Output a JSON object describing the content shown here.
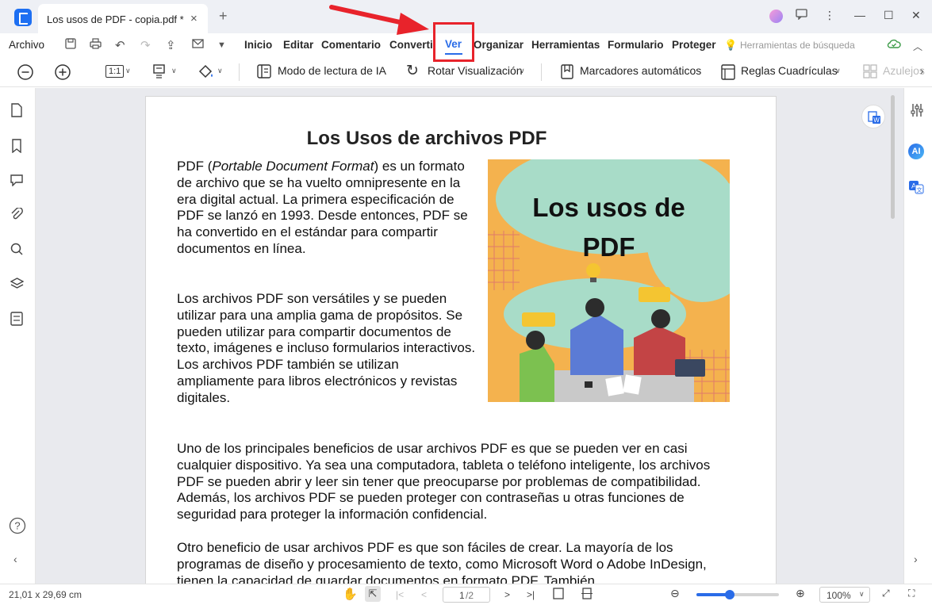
{
  "window": {
    "tab_title": "Los usos de PDF - copia.pdf *",
    "tab_close": "×",
    "new_tab": "+",
    "minimize": "—",
    "maximize": "☐",
    "close": "✕"
  },
  "menu": {
    "file": "Archivo",
    "items": [
      "Inicio",
      "Editar",
      "Comentario",
      "Converti",
      "Ver",
      "Organizar",
      "Herramientas",
      "Formulario",
      "Proteger"
    ],
    "search_tools": "Herramientas de búsqueda"
  },
  "toolbar": {
    "zoom_out_icon": "zoom-out",
    "zoom_in_icon": "zoom-in",
    "actual_size": "1:1",
    "ai_reading": "Modo de lectura de IA",
    "rotate": "Rotar Visualización",
    "bookmarks": "Marcadores automáticos",
    "rulers": "Reglas",
    "grids": "Cuadrículas",
    "tiles": "Azulejos"
  },
  "document": {
    "title": "Los Usos de archivos PDF",
    "p1_prefix": "PDF (",
    "p1_italic": "Portable Document Format",
    "p1_rest": ") es un formato de archivo que se ha vuelto omnipresente en la era digital actual. La primera especificación de PDF se lanzó en 1993. Desde entonces, PDF se ha convertido en el estándar para compartir documentos en línea.",
    "p2": "Los archivos PDF son versátiles y se pueden utilizar para una amplia gama de propósitos. Se pueden utilizar para compartir documentos de texto, imágenes e incluso formularios interactivos. Los archivos PDF también se utilizan ampliamente para libros electrónicos y revistas digitales.",
    "p3": "Uno de los principales beneficios de usar archivos PDF es que se pueden ver en casi cualquier dispositivo. Ya sea una computadora, tableta o teléfono inteligente, los archivos PDF se pueden abrir y leer sin tener que preocuparse por problemas de compatibilidad. Además, los archivos PDF se pueden proteger con contraseñas u otras funciones de seguridad para proteger la información confidencial.",
    "p4": "Otro beneficio de usar archivos PDF es que son fáciles de crear. La mayoría de los programas de diseño y procesamiento de texto, como Microsoft Word o Adobe InDesign, tienen la capacidad de guardar documentos en formato PDF. También",
    "image_title_line1": "Los usos de",
    "image_title_line2": "PDF"
  },
  "status": {
    "page_size": "21,01 x 29,69 cm",
    "page_current": "1",
    "page_total": "/2",
    "zoom": "100%",
    "zoom_level": 0.4
  },
  "colors": {
    "accent": "#2a6ce8",
    "highlight": "#e8232b",
    "brand": "#1d6ff2"
  }
}
